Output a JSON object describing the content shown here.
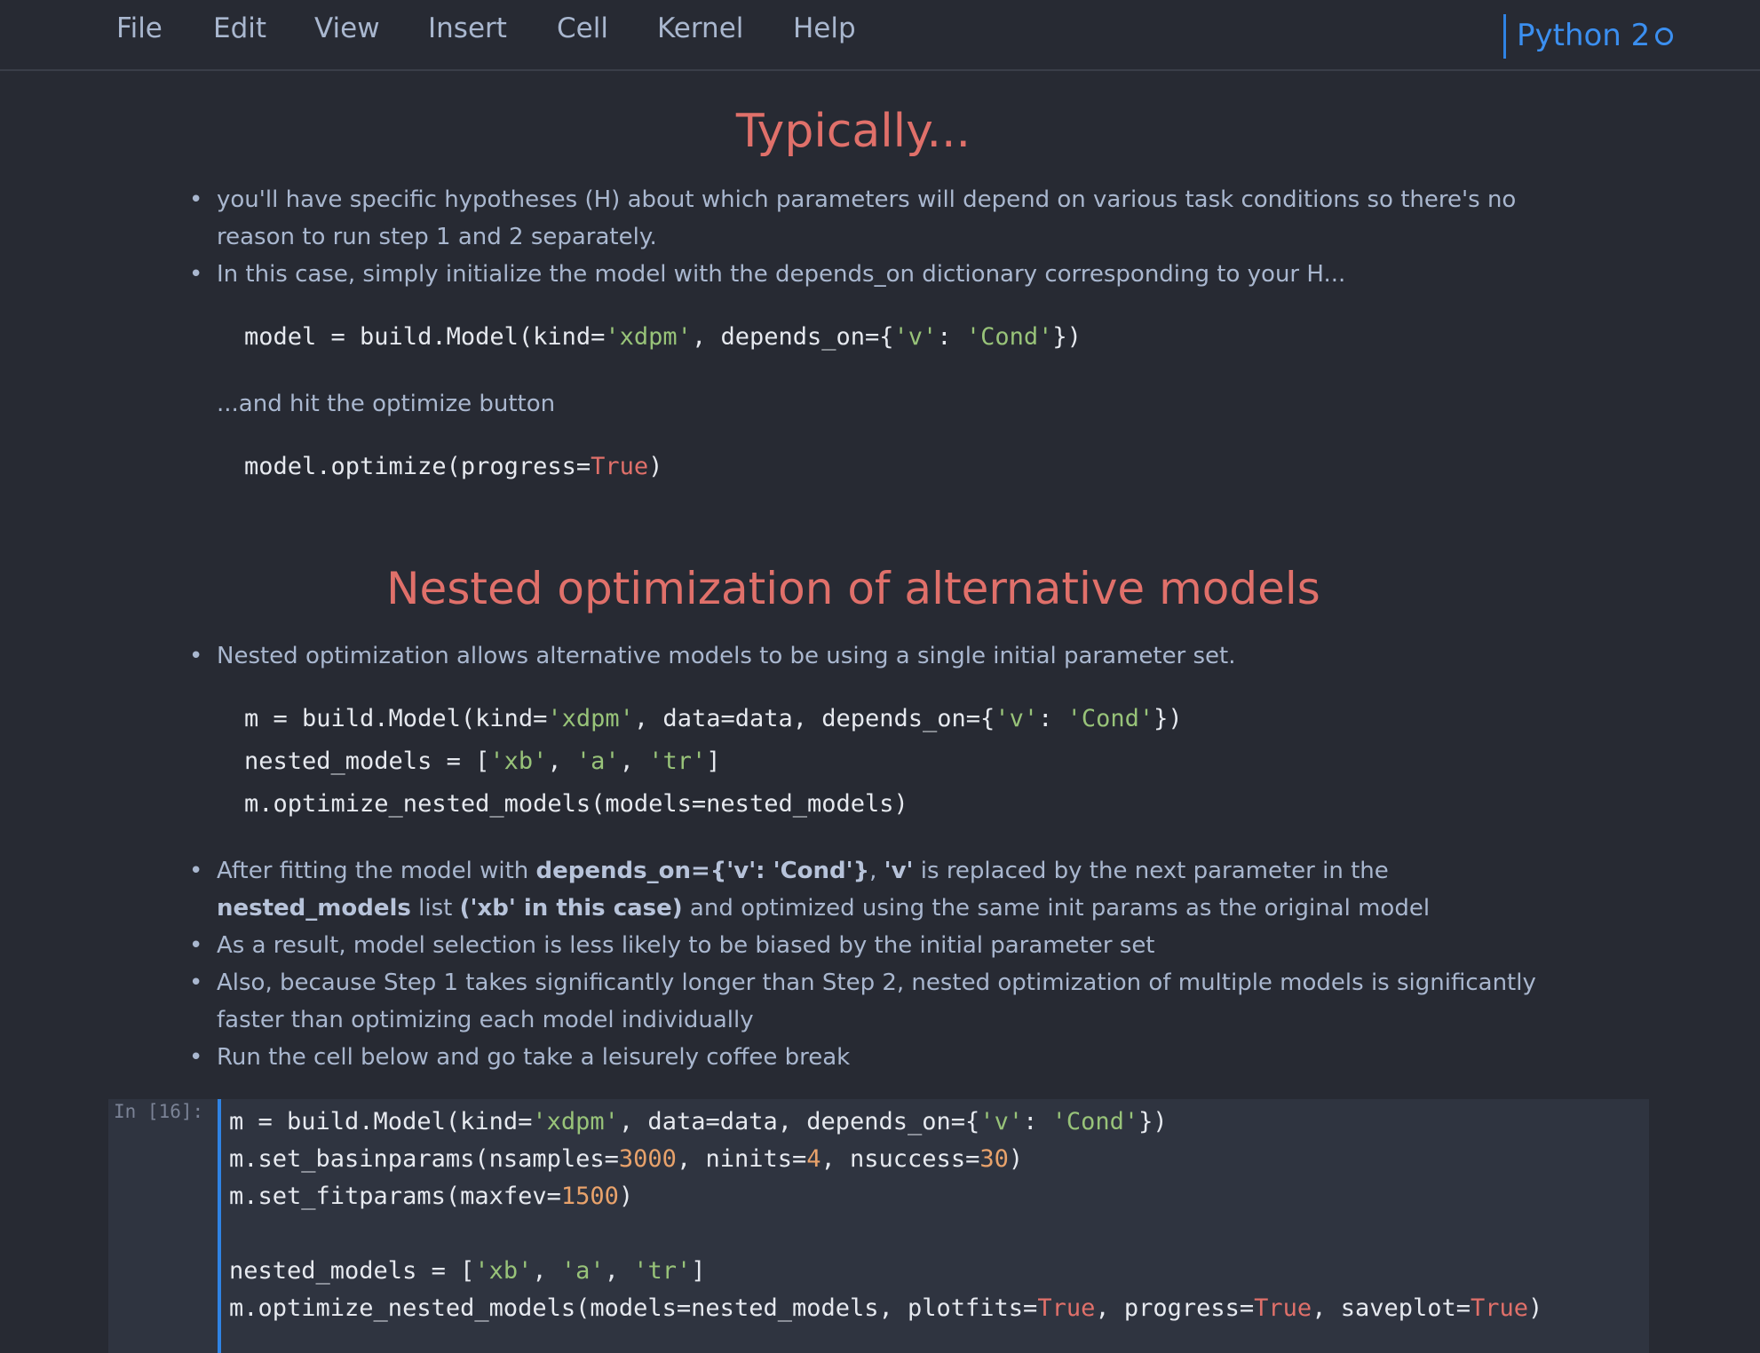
{
  "menu": [
    "File",
    "Edit",
    "View",
    "Insert",
    "Cell",
    "Kernel",
    "Help"
  ],
  "kernel": {
    "name": "Python 2"
  },
  "section1": {
    "heading": "Typically...",
    "bullets": [
      "you'll have specific hypotheses (H) about which parameters will depend on various task conditions so there's no reason to run step 1 and 2 separately.",
      "In this case, simply initialize the model with the depends_on dictionary corresponding to your H..."
    ],
    "code1": {
      "a": "model = build.Model(kind=",
      "s1": "'xdpm'",
      "b": ", depends_on={",
      "s2": "'v'",
      "c": ": ",
      "s3": "'Cond'",
      "d": "})"
    },
    "middle_text": "...and hit the optimize button",
    "code2": {
      "a": "model.optimize(progress=",
      "kw": "True",
      "b": ")"
    }
  },
  "section2": {
    "heading": "Nested optimization of alternative models",
    "bullet_intro": "Nested optimization allows alternative models to be using a single initial parameter set.",
    "code": {
      "l1a": "m = build.Model(kind=",
      "l1s1": "'xdpm'",
      "l1b": ", data=data, depends_on={",
      "l1s2": "'v'",
      "l1c": ": ",
      "l1s3": "'Cond'",
      "l1d": "})",
      "l2a": "nested_models = [",
      "l2s1": "'xb'",
      "l2b": ", ",
      "l2s2": "'a'",
      "l2c": ", ",
      "l2s3": "'tr'",
      "l2d": "]",
      "l3": "m.optimize_nested_models(models=nested_models)"
    },
    "bullet_after": {
      "t1": "After fitting the model with ",
      "b1": "depends_on={'v': 'Cond'}",
      "t2": ", ",
      "b2": "'v'",
      "t3": " is replaced by the next parameter in the ",
      "b3": "nested_models",
      "t4": " list ",
      "b4": "('xb' in this case)",
      "t5": " and optimized using the same init params as the original model"
    },
    "bullets_more": [
      "As a result, model selection is less likely to be biased by the initial parameter set",
      "Also, because Step 1 takes significantly longer than Step 2, nested optimization of multiple models is significantly faster than optimizing each model individually",
      "Run the cell below and go take a leisurely coffee break"
    ]
  },
  "cell": {
    "prompt": "In [16]:",
    "l1a": "m = build.Model(kind=",
    "l1s1": "'xdpm'",
    "l1b": ", data=data, depends_on={",
    "l1s2": "'v'",
    "l1c": ": ",
    "l1s3": "'Cond'",
    "l1d": "})",
    "l2a": "m.set_basinparams(nsamples=",
    "l2n1": "3000",
    "l2b": ", ninits=",
    "l2n2": "4",
    "l2c": ", nsuccess=",
    "l2n3": "30",
    "l2d": ")",
    "l3a": "m.set_fitparams(maxfev=",
    "l3n1": "1500",
    "l3b": ")",
    "l5a": "nested_models = [",
    "l5s1": "'xb'",
    "l5b": ", ",
    "l5s2": "'a'",
    "l5c": ", ",
    "l5s3": "'tr'",
    "l5d": "]",
    "l6a": "m.optimize_nested_models(models=nested_models, plotfits=",
    "l6k1": "True",
    "l6b": ", progress=",
    "l6k2": "True",
    "l6c": ", saveplot=",
    "l6k3": "True",
    "l6d": ")"
  }
}
